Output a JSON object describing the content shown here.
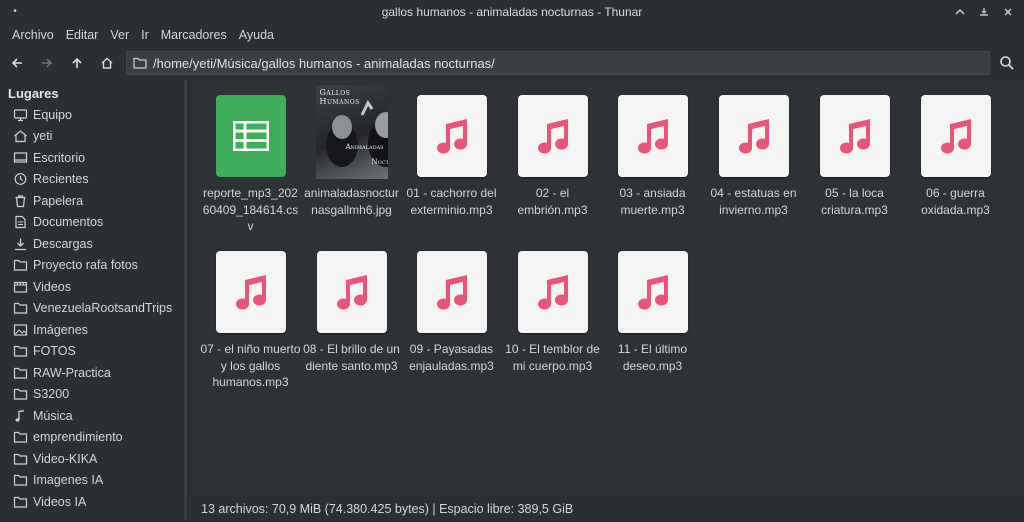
{
  "window": {
    "title": "gallos humanos - animaladas nocturnas - Thunar",
    "menu_glyph": "•"
  },
  "menubar": [
    "Archivo",
    "Editar",
    "Ver",
    "Ir",
    "Marcadores",
    "Ayuda"
  ],
  "location": {
    "path": "/home/yeti/Música/gallos humanos - animaladas nocturnas/"
  },
  "sidebar": {
    "header": "Lugares",
    "items": [
      {
        "label": "Equipo",
        "icon": "computer-icon"
      },
      {
        "label": "yeti",
        "icon": "home-icon"
      },
      {
        "label": "Escritorio",
        "icon": "desktop-icon"
      },
      {
        "label": "Recientes",
        "icon": "recent-icon"
      },
      {
        "label": "Papelera",
        "icon": "trash-icon"
      },
      {
        "label": "Documentos",
        "icon": "document-icon"
      },
      {
        "label": "Descargas",
        "icon": "download-icon"
      },
      {
        "label": "Proyecto rafa fotos",
        "icon": "folder-icon"
      },
      {
        "label": "Videos",
        "icon": "video-icon"
      },
      {
        "label": "VenezuelaRootsandTrips",
        "icon": "folder-icon"
      },
      {
        "label": "Imágenes",
        "icon": "image-icon"
      },
      {
        "label": "FOTOS",
        "icon": "folder-icon"
      },
      {
        "label": "RAW-Practica",
        "icon": "folder-icon"
      },
      {
        "label": "S3200",
        "icon": "folder-icon"
      },
      {
        "label": "Música",
        "icon": "music-icon"
      },
      {
        "label": "emprendimiento",
        "icon": "folder-icon"
      },
      {
        "label": "Video-KIKA",
        "icon": "folder-icon"
      },
      {
        "label": "Imagenes IA",
        "icon": "folder-icon"
      },
      {
        "label": "Videos IA",
        "icon": "folder-icon"
      }
    ]
  },
  "files": [
    {
      "name": "reporte_mp3_20260409_184614.csv",
      "type": "spreadsheet"
    },
    {
      "name": "animaladasnocturnasgallmh6.jpg",
      "type": "image",
      "cover_title": "Gallos Humanos",
      "cover_sub1": "Animaladas",
      "cover_sub2": "Nocturnas"
    },
    {
      "name": "01 - cachorro del exterminio.mp3",
      "type": "audio"
    },
    {
      "name": "02 - el embrión.mp3",
      "type": "audio"
    },
    {
      "name": "03 - ansiada muerte.mp3",
      "type": "audio"
    },
    {
      "name": "04 - estatuas en invierno.mp3",
      "type": "audio"
    },
    {
      "name": "05 - la loca criatura.mp3",
      "type": "audio"
    },
    {
      "name": "06 - guerra oxidada.mp3",
      "type": "audio"
    },
    {
      "name": "07 - el niño muerto y los gallos humanos.mp3",
      "type": "audio"
    },
    {
      "name": "08 - El brillo de un diente santo.mp3",
      "type": "audio"
    },
    {
      "name": "09 - Payasadas enjauladas.mp3",
      "type": "audio"
    },
    {
      "name": "10 - El temblor de mi cuerpo.mp3",
      "type": "audio"
    },
    {
      "name": "11 - El último deseo.mp3",
      "type": "audio"
    }
  ],
  "statusbar": {
    "text": "13 archivos: 70,9 MiB (74.380.425 bytes)  |  Espacio libre: 389,5 GiB"
  },
  "colors": {
    "music_note": "#e8557a",
    "sheet_green": "#3fae5a"
  }
}
